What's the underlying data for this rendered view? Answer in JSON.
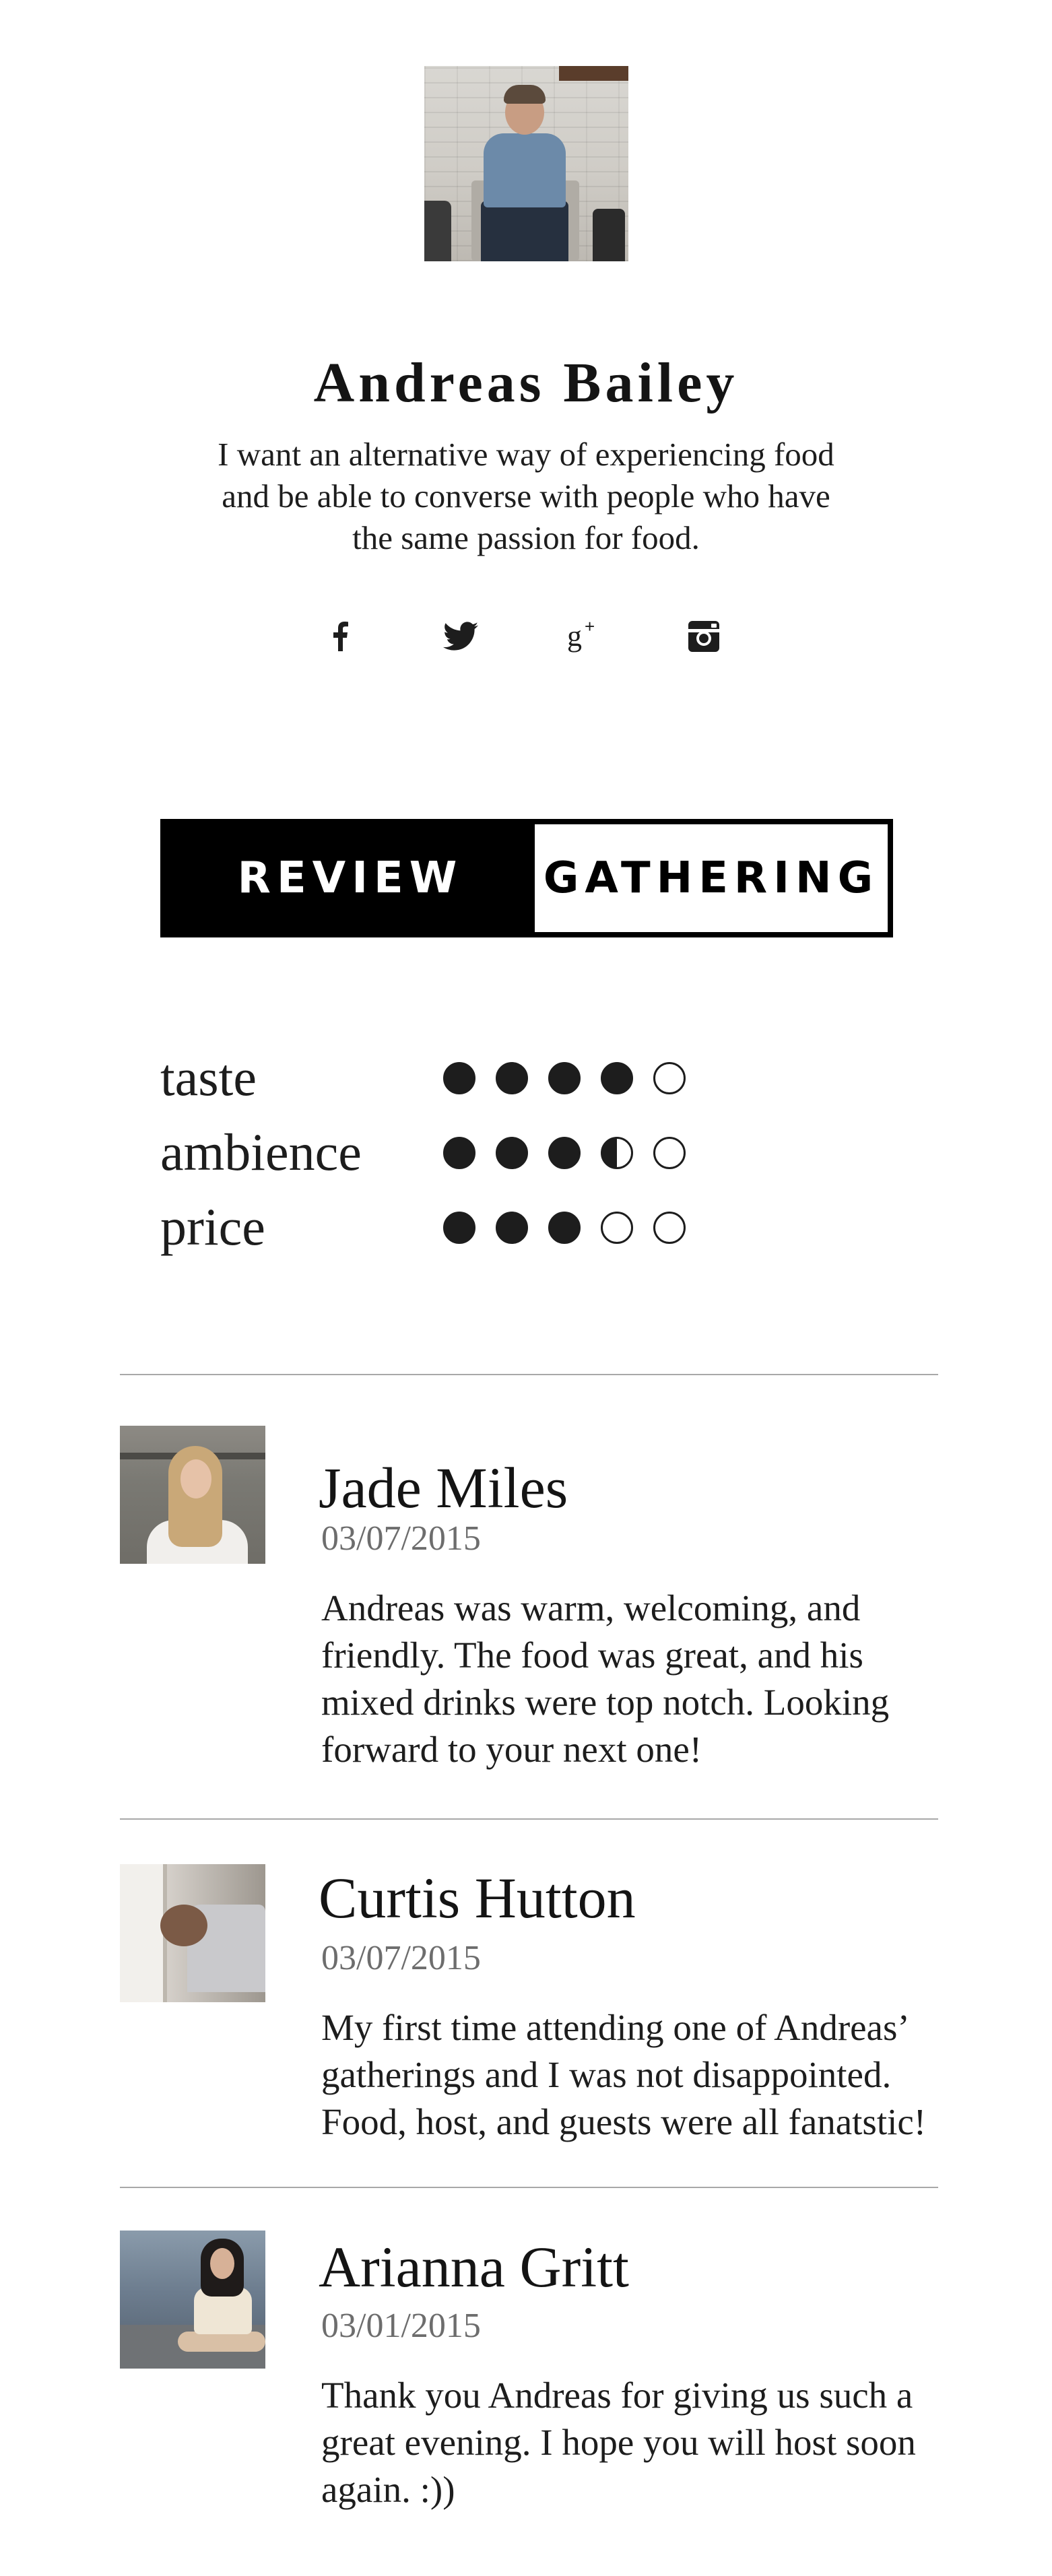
{
  "profile": {
    "name": "Andreas Bailey",
    "bio_lines": [
      "I want an alternative way of experiencing food",
      "and be able to converse with people who have",
      "the same passion for food."
    ],
    "avatar_icon": "person-photo"
  },
  "social": [
    {
      "name": "facebook",
      "icon": "facebook-icon"
    },
    {
      "name": "twitter",
      "icon": "twitter-icon"
    },
    {
      "name": "google-plus",
      "icon": "google-plus-icon"
    },
    {
      "name": "instagram",
      "icon": "instagram-icon"
    }
  ],
  "tabs": {
    "review_label": "REVIEW",
    "gathering_label": "GATHERING",
    "active": "review"
  },
  "ratings": [
    {
      "label": "taste",
      "score": 4,
      "max": 5
    },
    {
      "label": "ambience",
      "score": 3.5,
      "max": 5
    },
    {
      "label": "price",
      "score": 3,
      "max": 5
    }
  ],
  "reviews": [
    {
      "name": "Jade Miles",
      "date": "03/07/2015",
      "text_lines": [
        "Andreas was warm, welcoming, and",
        "friendly. The food was great, and his",
        "mixed drinks were top notch. Looking",
        "forward to your next one!"
      ]
    },
    {
      "name": "Curtis Hutton",
      "date": "03/07/2015",
      "text_lines": [
        "My first time attending one of Andreas’",
        "gatherings and I was not disappointed.",
        "Food, host, and guests were all fanatstic!"
      ]
    },
    {
      "name": "Arianna Gritt",
      "date": "03/01/2015",
      "text_lines": [
        "Thank you Andreas for giving us such a",
        "great evening. I hope you will host soon",
        "again. :))"
      ]
    }
  ],
  "colors": {
    "text": "#1d1d1d",
    "muted": "#6d6d6d",
    "divider": "#a8a8a8",
    "tab_active_bg": "#000000",
    "tab_active_text": "#ffffff"
  }
}
